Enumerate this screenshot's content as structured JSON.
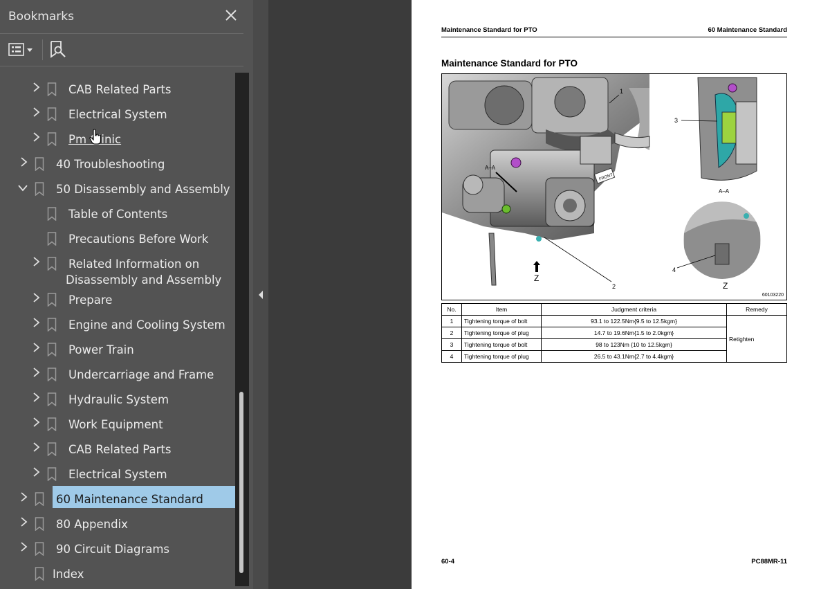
{
  "sidebar": {
    "title": "Bookmarks",
    "close_icon": "close-icon",
    "toolbar": {
      "options_icon": "list-options-icon",
      "find_icon": "find-bookmark-icon"
    },
    "items": [
      {
        "label": "CAB Related Parts",
        "level": 2,
        "expandable": true
      },
      {
        "label": "Electrical System",
        "level": 2,
        "expandable": true
      },
      {
        "label": "Pm Clinic",
        "level": 2,
        "expandable": true,
        "underlined": true
      },
      {
        "label": "40 Troubleshooting",
        "level": 1,
        "expandable": true
      },
      {
        "label": "50 Disassembly and Assembly",
        "level": 1,
        "expandable": true,
        "expanded": true
      },
      {
        "label": "Table of Contents",
        "level": 2,
        "expandable": false
      },
      {
        "label": "Precautions Before Work",
        "level": 2,
        "expandable": false
      },
      {
        "label": "Related Information on",
        "label2": "Disassembly and Assembly",
        "level": 2,
        "expandable": true
      },
      {
        "label": "Prepare",
        "level": 2,
        "expandable": true
      },
      {
        "label": "Engine and Cooling System",
        "level": 2,
        "expandable": true
      },
      {
        "label": "Power Train",
        "level": 2,
        "expandable": true
      },
      {
        "label": "Undercarriage and Frame",
        "level": 2,
        "expandable": true
      },
      {
        "label": "Hydraulic System",
        "level": 2,
        "expandable": true
      },
      {
        "label": "Work Equipment",
        "level": 2,
        "expandable": true
      },
      {
        "label": "CAB Related Parts",
        "level": 2,
        "expandable": true
      },
      {
        "label": "Electrical System",
        "level": 2,
        "expandable": true
      },
      {
        "label": "60 Maintenance Standard",
        "level": 1,
        "expandable": true,
        "selected": true
      },
      {
        "label": "80 Appendix",
        "level": 1,
        "expandable": true
      },
      {
        "label": "90 Circuit Diagrams",
        "level": 1,
        "expandable": true
      },
      {
        "label": "Index",
        "level": 1,
        "expandable": false
      }
    ]
  },
  "page": {
    "header_left": "Maintenance Standard for PTO",
    "header_right": "60 Maintenance Standard",
    "title": "Maintenance Standard for PTO",
    "figure": {
      "labels": {
        "callout_1": "1",
        "callout_2": "2",
        "callout_3": "3",
        "callout_4": "4",
        "view_z": "Z",
        "view_z2": "Z",
        "section_aa": "A–A",
        "section_marker": "A–A",
        "front": "FRONT"
      },
      "figure_id": "60103220"
    },
    "table": {
      "headers": [
        "No.",
        "Item",
        "Judgment criteria",
        "Remedy"
      ],
      "rows": [
        {
          "no": "1",
          "item": "Tightening torque of bolt",
          "criteria": "93.1 to 122.5Nm{9.5 to 12.5kgm}"
        },
        {
          "no": "2",
          "item": "Tightening torque of plug",
          "criteria": "14.7 to 19.6Nm{1.5 to 2.0kgm}"
        },
        {
          "no": "3",
          "item": "Tightening torque of bolt",
          "criteria": "98 to 123Nm {10 to 12.5kgm}"
        },
        {
          "no": "4",
          "item": "Tightening torque of plug",
          "criteria": "26.5 to 43.1Nm{2.7 to 4.4kgm}"
        }
      ],
      "remedy": "Retighten"
    },
    "footer_left": "60-4",
    "footer_right": "PC88MR-11"
  },
  "colors": {
    "sidebar_bg": "#535353",
    "selection": "#9fcae8",
    "viewer_bg": "#3b3b3b"
  }
}
